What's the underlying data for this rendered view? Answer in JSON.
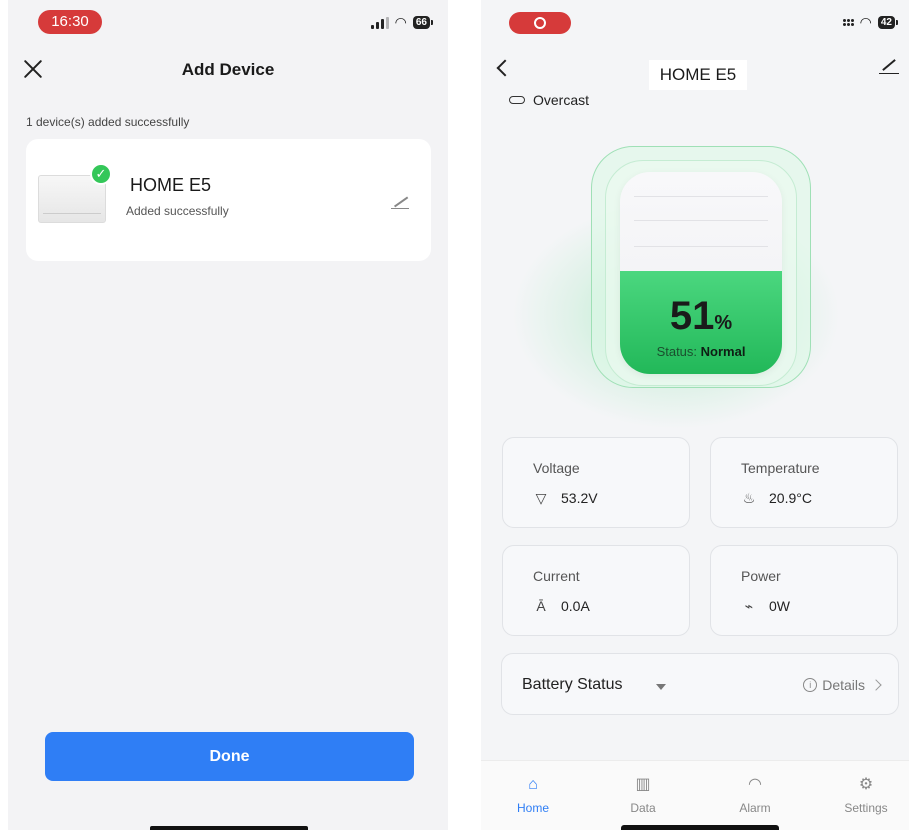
{
  "left": {
    "status_time": "16:30",
    "battery_level": "66",
    "title": "Add Device",
    "success_note": "1 device(s) added successfully",
    "device": {
      "name": "HOME E5",
      "status": "Added successfully",
      "check_glyph": "✓"
    },
    "done_label": "Done",
    "icons": [
      "close-icon",
      "check-icon",
      "edit-icon"
    ]
  },
  "right": {
    "battery_level": "42",
    "title": "HOME E5",
    "weather": "Overcast",
    "charge": {
      "value": "51",
      "unit": "%",
      "fraction": 0.51,
      "status_prefix": "Status: ",
      "status_value": "Normal"
    },
    "metrics": [
      {
        "label": "Voltage",
        "value": "53.2V",
        "icon": "voltage-icon"
      },
      {
        "label": "Temperature",
        "value": "20.9°C",
        "icon": "thermometer-icon"
      },
      {
        "label": "Current",
        "value": "0.0A",
        "icon": "current-icon"
      },
      {
        "label": "Power",
        "value": "0W",
        "icon": "power-icon"
      }
    ],
    "battery_status": {
      "label": "Battery Status",
      "details_label": "Details"
    },
    "tabs": [
      {
        "label": "Home",
        "icon": "home-icon",
        "active": true
      },
      {
        "label": "Data",
        "icon": "chart-icon",
        "active": false
      },
      {
        "label": "Alarm",
        "icon": "bell-icon",
        "active": false
      },
      {
        "label": "Settings",
        "icon": "gear-icon",
        "active": false
      }
    ],
    "colors": {
      "accent": "#2f7ef5",
      "charge_green": "#34c759",
      "record": "#d63a3a"
    }
  }
}
